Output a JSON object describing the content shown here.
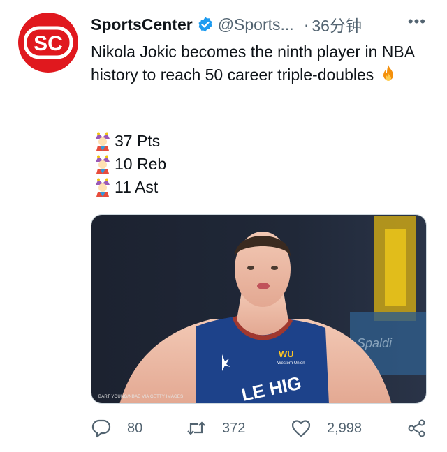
{
  "tweet": {
    "author_name": "SportsCenter",
    "handle": "@Sports...",
    "separator": "·",
    "time": "36分钟",
    "more_label": "•••",
    "text_line": "Nikola Jokic becomes the ninth player in NBA history to reach 50 career triple-doubles",
    "stats": [
      "37 Pts",
      "10 Reb",
      "11 Ast"
    ],
    "media": {
      "credit": "BART YOUNG/NBAE VIA GETTY IMAGES",
      "jersey_logo": "WU",
      "jersey_logo_sub": "Western Union",
      "jersey_text": "LE HIG"
    }
  },
  "actions": {
    "reply_count": "80",
    "retweet_count": "372",
    "like_count": "2,998"
  },
  "colors": {
    "brand_red": "#e0181e",
    "verified_blue": "#1d9bf0",
    "muted_text": "#536471",
    "jersey_blue": "#1d428a"
  },
  "icons": {
    "avatar": "sc-logo-icon",
    "verified": "verified-badge-icon",
    "fire": "fire-emoji-icon",
    "joker": "joker-emoji-icon",
    "reply": "reply-icon",
    "retweet": "retweet-icon",
    "like": "heart-icon",
    "share": "share-icon"
  }
}
